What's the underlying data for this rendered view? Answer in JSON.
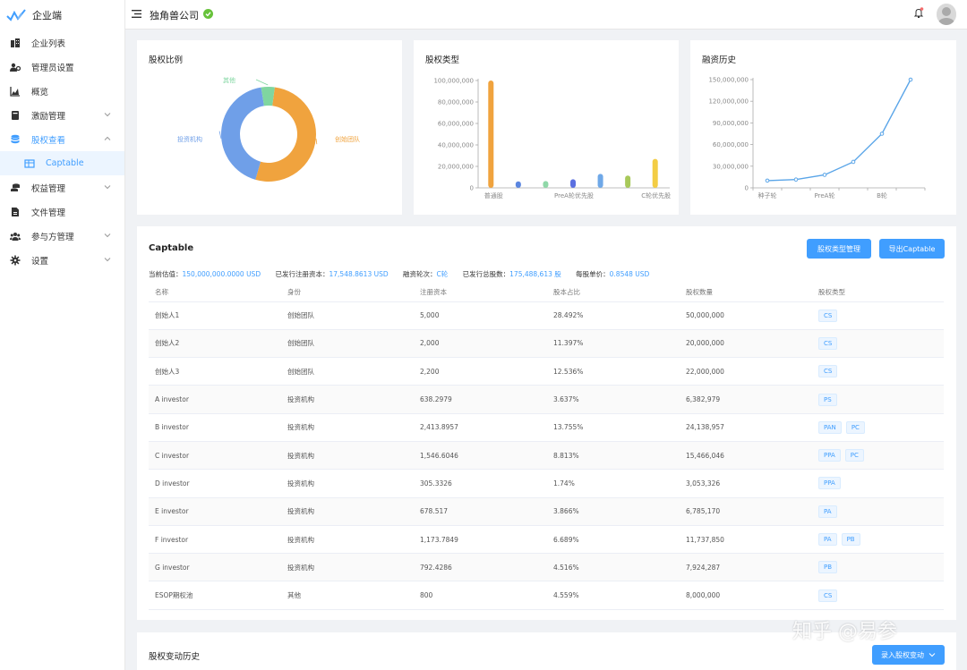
{
  "app": {
    "name": "企业端"
  },
  "header": {
    "company": "独角兽公司"
  },
  "sidebar": {
    "items": [
      {
        "label": "企业列表",
        "icon": "building-icon"
      },
      {
        "label": "管理员设置",
        "icon": "users-cog-icon"
      },
      {
        "label": "概览",
        "icon": "area-chart-icon"
      },
      {
        "label": "激励管理",
        "icon": "book-icon",
        "expandable": true
      },
      {
        "label": "股权查看",
        "icon": "database-icon",
        "expandable": true,
        "expanded": true
      },
      {
        "label": "Captable",
        "icon": "table-icon",
        "sub": true,
        "active": true
      },
      {
        "label": "权益管理",
        "icon": "coins-icon",
        "expandable": true
      },
      {
        "label": "文件管理",
        "icon": "file-icon"
      },
      {
        "label": "参与方管理",
        "icon": "group-icon",
        "expandable": true
      },
      {
        "label": "设置",
        "icon": "gear-icon",
        "expandable": true
      }
    ]
  },
  "colors": {
    "accent": "#409eff",
    "orange": "#f0a33e",
    "blue": "#6f9fe8",
    "green": "#7fd6a0",
    "line": "#5aa5e8"
  },
  "cards": {
    "equity_ratio": {
      "title": "股权比例"
    },
    "equity_type": {
      "title": "股权类型"
    },
    "funding_history": {
      "title": "融资历史"
    }
  },
  "chart_data": [
    {
      "type": "pie",
      "labels": [
        "创始团队",
        "投资机构",
        "其他"
      ],
      "values": [
        52.425,
        42.99,
        4.585
      ],
      "colors": [
        "#f0a33e",
        "#6f9fe8",
        "#7fd6a0"
      ]
    },
    {
      "type": "bar",
      "categories": [
        "普通股",
        "",
        "PreA轮优先股",
        "",
        "C轮优先股"
      ],
      "visible_ticks": [
        "普通股",
        "PreA轮优先股",
        "C轮优先股"
      ],
      "values": [
        100000000,
        6000000,
        6400000,
        8000000,
        13000000,
        11500000,
        27000000
      ],
      "bar_colors": [
        "#f0a33e",
        "#5b86e0",
        "#8fd8a8",
        "#5b6fe0",
        "#6fa8e8",
        "#a8c95a",
        "#f3cd45"
      ],
      "yticks": [
        "0",
        "20,000,000",
        "40,000,000",
        "60,000,000",
        "80,000,000",
        "100,000,000"
      ],
      "ylim": [
        0,
        100000000
      ]
    },
    {
      "type": "line",
      "x": [
        "种子轮",
        "",
        "PreA轮",
        "",
        "B轮",
        ""
      ],
      "visible_ticks": [
        "种子轮",
        "PreA轮",
        "B轮"
      ],
      "values": [
        10000000,
        11500000,
        18000000,
        36000000,
        75000000,
        150000000
      ],
      "yticks": [
        "0",
        "30,000,000",
        "60,000,000",
        "90,000,000",
        "120,000,000",
        "150,000,000"
      ],
      "ylim": [
        0,
        150000000
      ]
    }
  ],
  "captable": {
    "title": "Captable",
    "btn_type_mgmt": "股权类型管理",
    "btn_export": "导出Captable",
    "summary": {
      "valuation_label": "当前估值：",
      "valuation": "150,000,000.0000 USD",
      "registered_label": "已发行注册资本：",
      "registered": "17,548.8613 USD",
      "round_label": "融资轮次：",
      "round": "C轮",
      "shares_label": "已发行总股数：",
      "shares": "175,488,613 股",
      "price_label": "每股单价：",
      "price": "0.8548 USD"
    },
    "columns": [
      "名称",
      "身份",
      "注册资本",
      "股本占比",
      "股权数量",
      "股权类型"
    ],
    "rows": [
      [
        "创始人1",
        "创始团队",
        "5,000",
        "28.492%",
        "50,000,000",
        [
          "CS"
        ]
      ],
      [
        "创始人2",
        "创始团队",
        "2,000",
        "11.397%",
        "20,000,000",
        [
          "CS"
        ]
      ],
      [
        "创始人3",
        "创始团队",
        "2,200",
        "12.536%",
        "22,000,000",
        [
          "CS"
        ]
      ],
      [
        "A investor",
        "投资机构",
        "638.2979",
        "3.637%",
        "6,382,979",
        [
          "PS"
        ]
      ],
      [
        "B investor",
        "投资机构",
        "2,413.8957",
        "13.755%",
        "24,138,957",
        [
          "PAN",
          "PC"
        ]
      ],
      [
        "C investor",
        "投资机构",
        "1,546.6046",
        "8.813%",
        "15,466,046",
        [
          "PPA",
          "PC"
        ]
      ],
      [
        "D investor",
        "投资机构",
        "305.3326",
        "1.74%",
        "3,053,326",
        [
          "PPA"
        ]
      ],
      [
        "E investor",
        "投资机构",
        "678.517",
        "3.866%",
        "6,785,170",
        [
          "PA"
        ]
      ],
      [
        "F investor",
        "投资机构",
        "1,173.7849",
        "6.689%",
        "11,737,850",
        [
          "PA",
          "PB"
        ]
      ],
      [
        "G investor",
        "投资机构",
        "792.4286",
        "4.516%",
        "7,924,287",
        [
          "PB"
        ]
      ],
      [
        "ESOP期权池",
        "其他",
        "800",
        "4.559%",
        "8,000,000",
        [
          "CS"
        ]
      ]
    ]
  },
  "history": {
    "title": "股权变动历史",
    "btn_record": "录入股权变动"
  },
  "watermark": "知乎 @易参"
}
